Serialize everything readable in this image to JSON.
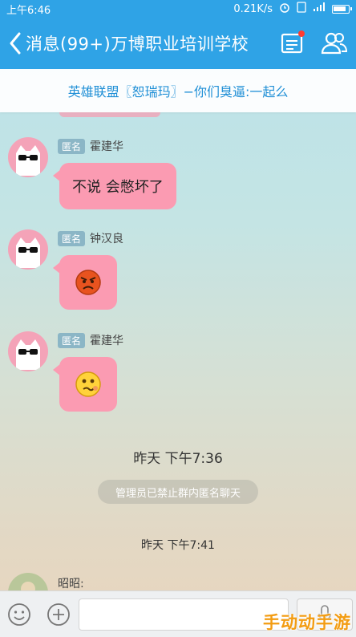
{
  "status_bar": {
    "time": "上午6:46",
    "speed": "0.21K/s"
  },
  "header": {
    "title": "消息(99+)万博职业培训学校"
  },
  "banner": {
    "text": "英雄联盟〖恕瑞玛〗−你们臭逼:一起么"
  },
  "messages": [
    {
      "tag": "匿名",
      "sender": "霍建华",
      "text": "不说 会憋坏了"
    },
    {
      "tag": "匿名",
      "sender": "钟汉良",
      "emoji": "angry-face-emoji"
    },
    {
      "tag": "匿名",
      "sender": "霍建华",
      "emoji": "smirk-face-emoji"
    }
  ],
  "time_1": "昨天 下午7:36",
  "system_notice": "管理员已禁止群内匿名聊天",
  "time_2": "昨天 下午7:41",
  "last_sender": "昭昭:",
  "input": {
    "placeholder": ""
  },
  "watermark": "手动动手游",
  "colors": {
    "header": "#2fa3e6",
    "bubble": "#fb9bb2",
    "tag": "#8bb6c6",
    "banner_text": "#1f8fd6"
  }
}
